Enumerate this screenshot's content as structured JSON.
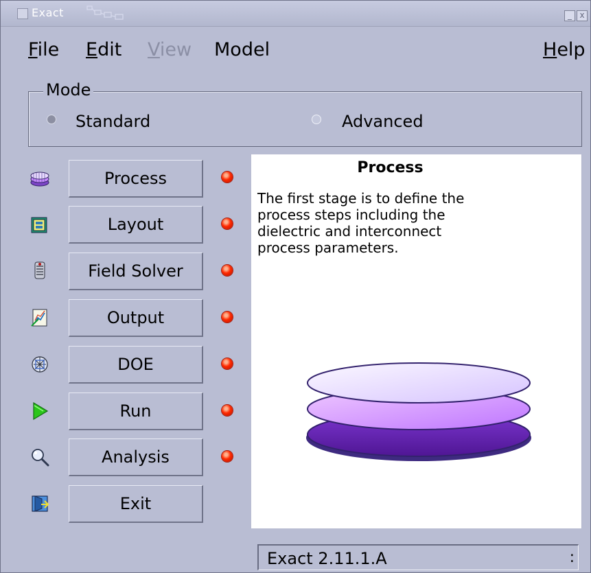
{
  "window": {
    "title": "Exact",
    "minimize_label": "_",
    "close_label": "x"
  },
  "menus": [
    {
      "label": "File",
      "mnemonic": "F",
      "rest": "ile",
      "enabled": true
    },
    {
      "label": "Edit",
      "mnemonic": "E",
      "rest": "dit",
      "enabled": true
    },
    {
      "label": "View",
      "mnemonic": "V",
      "rest": "iew",
      "enabled": false
    },
    {
      "label": "Model",
      "mnemonic": "",
      "rest": "Model",
      "enabled": true
    },
    {
      "label": "Help",
      "mnemonic": "H",
      "rest": "elp",
      "enabled": true
    }
  ],
  "mode": {
    "legend": "Mode",
    "options": [
      "Standard",
      "Advanced"
    ],
    "selected": "Standard"
  },
  "steps": [
    {
      "label": "Process",
      "icon": "wafer-stack-icon",
      "status": "red"
    },
    {
      "label": "Layout",
      "icon": "layout-icon",
      "status": "red"
    },
    {
      "label": "Field Solver",
      "icon": "field-solver-icon",
      "status": "red"
    },
    {
      "label": "Output",
      "icon": "output-chart-icon",
      "status": "red"
    },
    {
      "label": "DOE",
      "icon": "doe-icon",
      "status": "red"
    },
    {
      "label": "Run",
      "icon": "play-icon",
      "status": "red"
    },
    {
      "label": "Analysis",
      "icon": "magnifier-icon",
      "status": "red"
    },
    {
      "label": "Exit",
      "icon": "exit-door-icon",
      "status": ""
    }
  ],
  "info_panel": {
    "title": "Process",
    "description_lines": [
      "The first stage is to define the",
      "process steps including the",
      "dielectric and interconnect",
      "process parameters."
    ],
    "illustration": "wafer-stack-illustration"
  },
  "status_bar": {
    "text": "Exact 2.11.1.A",
    "tail": ":"
  },
  "colors": {
    "window_bg": "#b9bdd3",
    "led_red": "#ff2a00",
    "wafer_light": "#e7d8ff",
    "wafer_mid": "#c888ff",
    "wafer_dark": "#7a2fc6"
  }
}
